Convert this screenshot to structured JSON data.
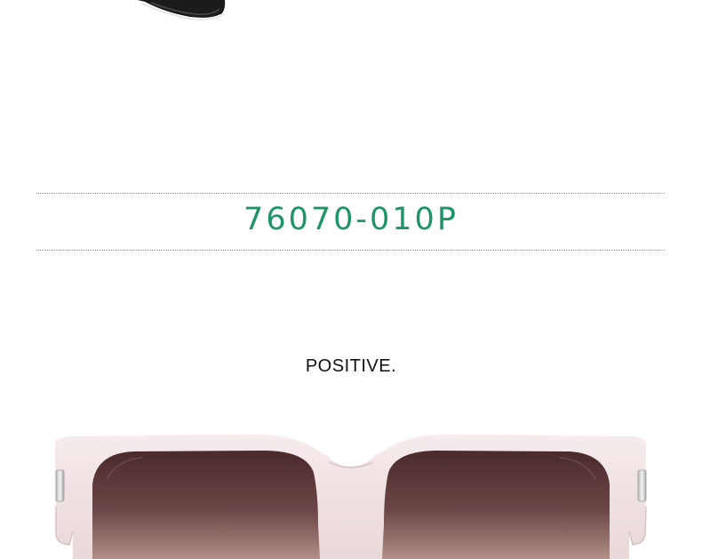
{
  "product": {
    "model_code": "76070-010P",
    "brand": "POSITIVE."
  },
  "colors": {
    "model_code_color": "#1e9566",
    "brand_color": "#111111",
    "divider_color": "#9a9a9a",
    "frame_color": "#f1e4e4",
    "lens_top_color": "#4a2a2b",
    "lens_bottom_color": "#b28f86",
    "previous_frame_color": "#1b1b1b"
  },
  "images": {
    "top": "black-sunglasses-frame-corner",
    "bottom": "pink-square-sunglasses-gradient-lenses"
  }
}
